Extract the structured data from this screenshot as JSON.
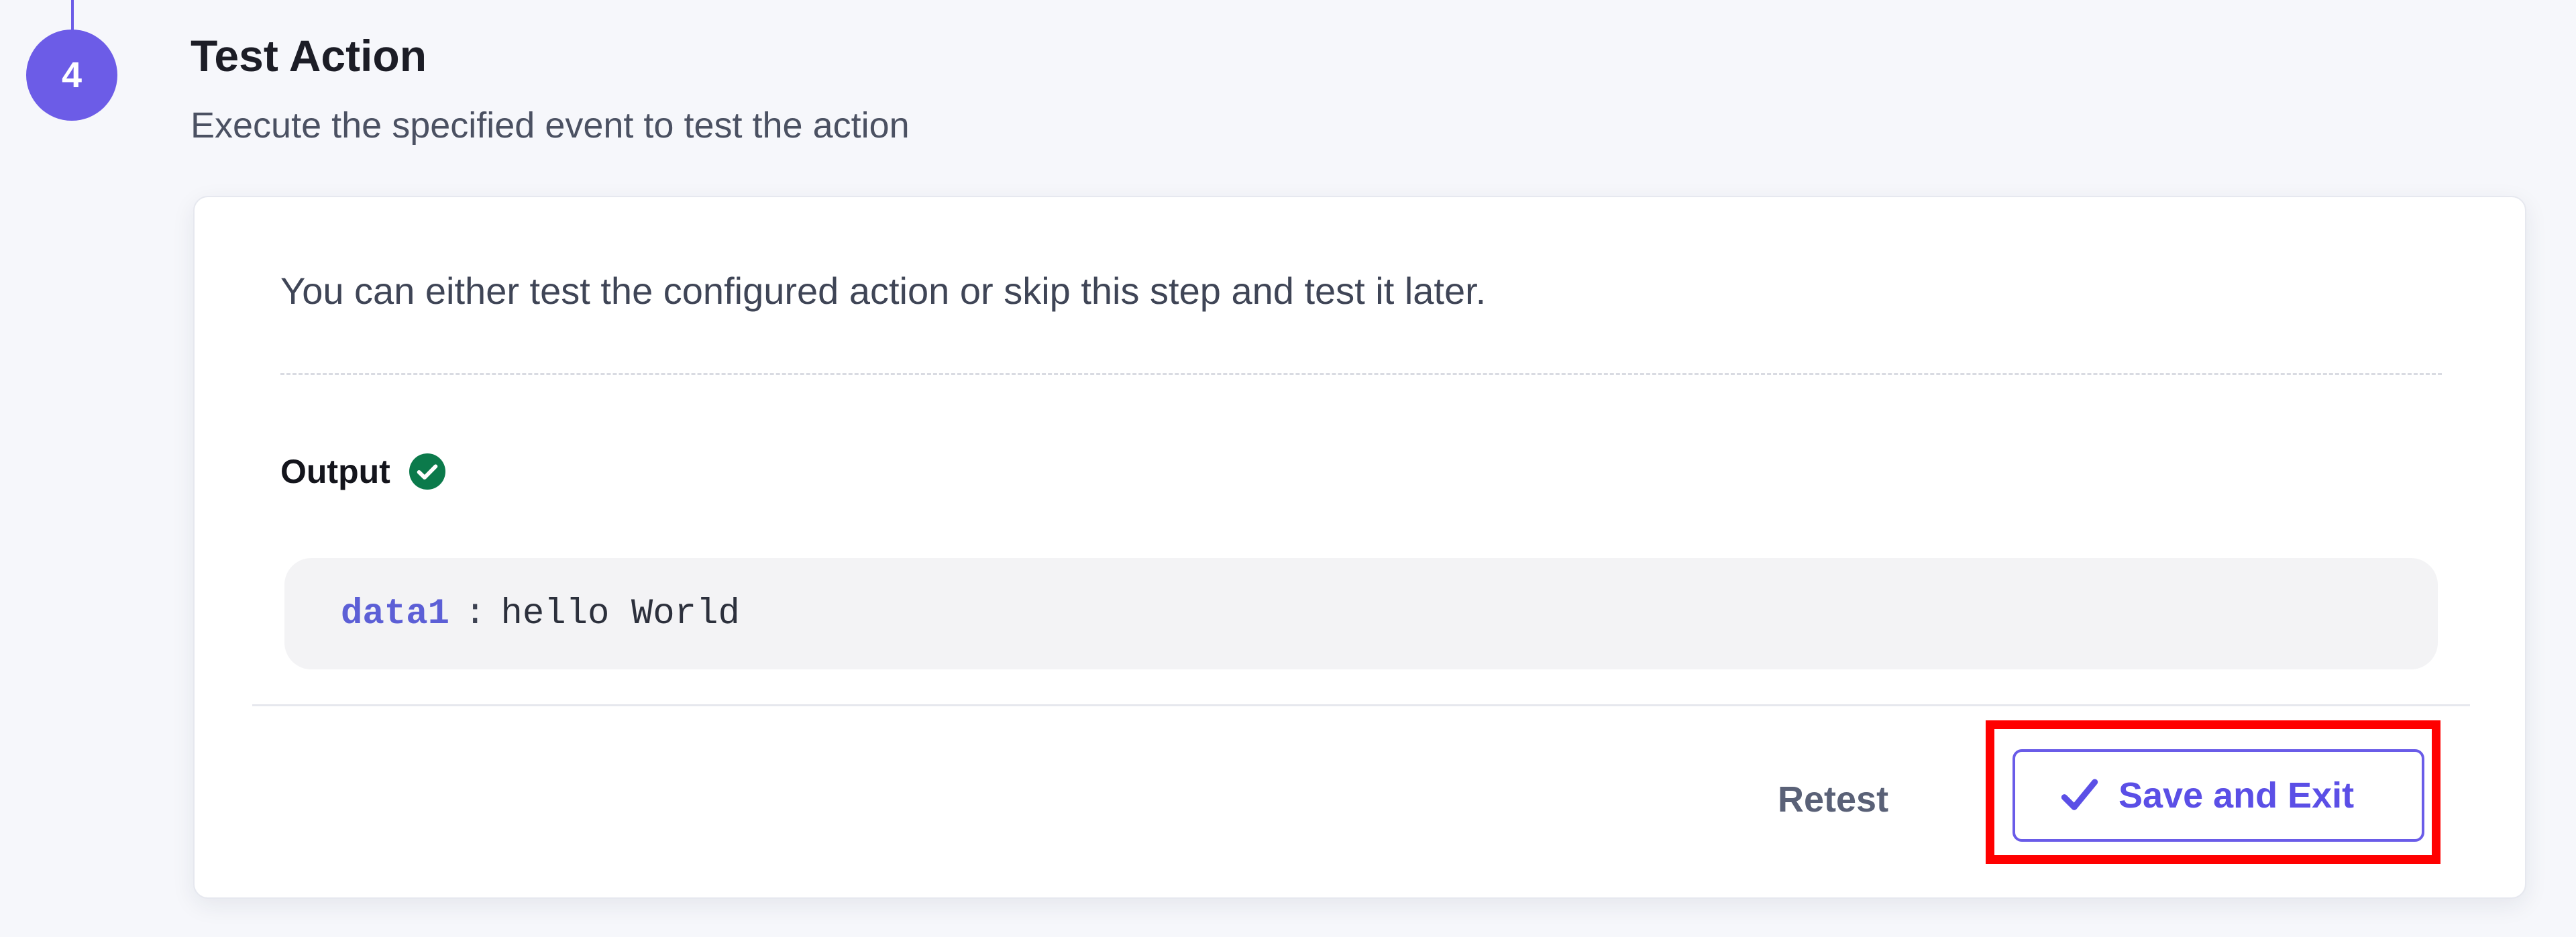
{
  "step": {
    "number": "4",
    "title": "Test Action",
    "subtitle": "Execute the specified event to test the action"
  },
  "card": {
    "description": "You can either test the configured action or skip this step and test it later.",
    "output_label": "Output",
    "output": {
      "key": "data1",
      "separator": ":",
      "value": "hello World"
    }
  },
  "actions": {
    "retest_label": "Retest",
    "save_label": "Save and Exit"
  },
  "icons": {
    "output_status": "check-circle-icon",
    "save": "checkmark-icon"
  },
  "colors": {
    "accent": "#6c5ce7",
    "success": "#0b7a4b",
    "highlight": "#ff0000"
  }
}
